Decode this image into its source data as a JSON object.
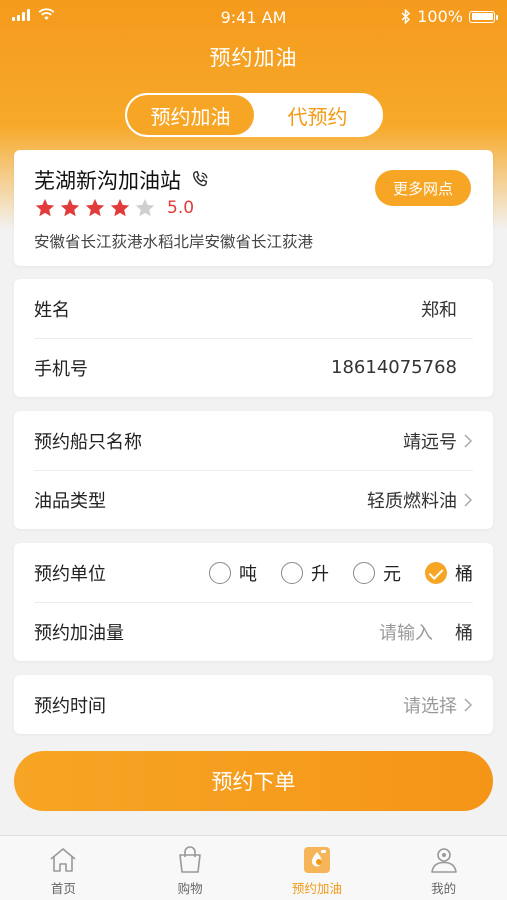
{
  "status_bar": {
    "time": "9:41 AM",
    "battery": "100%"
  },
  "header": {
    "title": "预约加油"
  },
  "segment": {
    "options": [
      "预约加油",
      "代预约"
    ],
    "active_index": 0
  },
  "station": {
    "name": "芜湖新沟加油站",
    "rating": "5.0",
    "stars_filled": 4,
    "stars_total": 5,
    "address": "安徽省长江荻港水稻北岸安徽省长江荻港",
    "more_button": "更多网点"
  },
  "contact": {
    "name_label": "姓名",
    "name_value": "郑和",
    "phone_label": "手机号",
    "phone_value": "18614075768"
  },
  "ship": {
    "ship_label": "预约船只名称",
    "ship_value": "靖远号",
    "oil_label": "油品类型",
    "oil_value": "轻质燃料油"
  },
  "amount": {
    "unit_label": "预约单位",
    "units": [
      "吨",
      "升",
      "元",
      "桶"
    ],
    "selected_unit": "桶",
    "qty_label": "预约加油量",
    "qty_placeholder": "请输入",
    "qty_unit": "桶"
  },
  "time": {
    "label": "预约时间",
    "placeholder": "请选择"
  },
  "submit_label": "预约下单",
  "tabbar": {
    "items": [
      {
        "label": "首页",
        "icon": "home-icon"
      },
      {
        "label": "购物",
        "icon": "shopping-bag-icon"
      },
      {
        "label": "预约加油",
        "icon": "fuel-reserve-icon"
      },
      {
        "label": "我的",
        "icon": "profile-icon"
      }
    ],
    "active_index": 2
  },
  "colors": {
    "accent": "#f7a524",
    "rating": "#e23b3b",
    "background": "#f2f2f2"
  }
}
